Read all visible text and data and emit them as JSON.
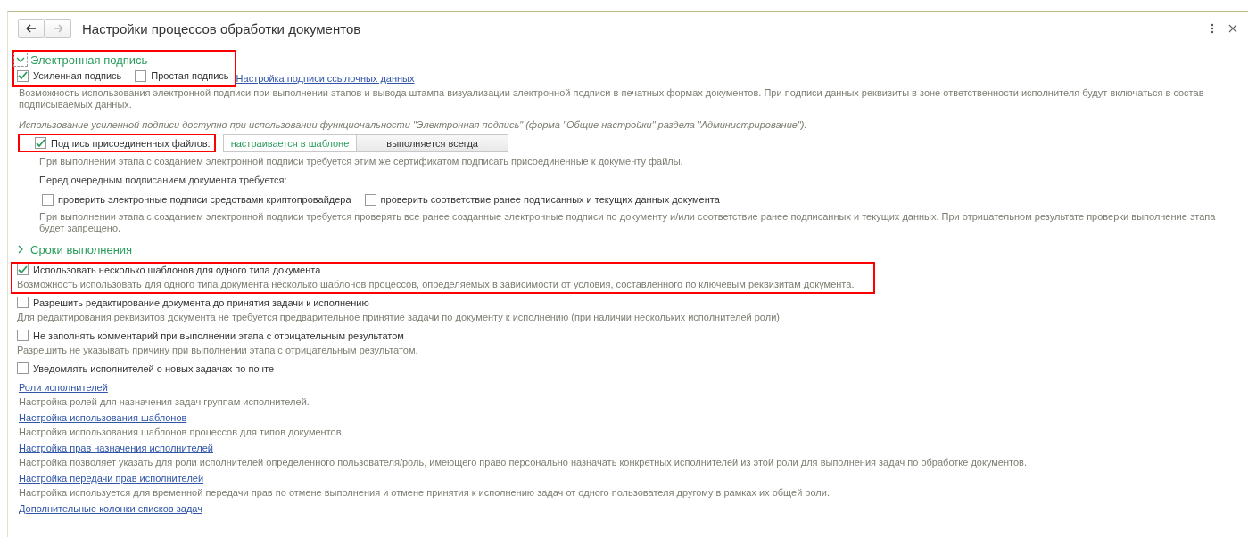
{
  "window": {
    "title": "Настройки процессов обработки документов"
  },
  "sections": [
    {
      "title": "Электронная подпись",
      "expanded": true,
      "highlighted": true,
      "signature_types": [
        {
          "label": "Усиленная подпись",
          "checked": true
        },
        {
          "label": "Простая подпись",
          "checked": false
        }
      ],
      "link": "Настройка подписи ссылочных данных",
      "description": "Возможность использования электронной подписи при выполнении этапов и вывода штампа визуализации электронной подписи в печатных формах документов. При подписи данных реквизиты в зоне ответственности исполнителя будут включаться в состав подписываемых данных.",
      "note": "Использование усиленной подписи доступно при использовании функциональности \"Электронная подпись\" (форма \"Общие настройки\" раздела \"Администрирование\").",
      "attached_files": {
        "label": "Подпись присоединенных файлов:",
        "checked": true,
        "highlighted": true,
        "modes": [
          {
            "label": "настраивается в шаблоне",
            "selected": true
          },
          {
            "label": "выполняется всегда",
            "selected": false
          }
        ],
        "description": "При выполнении этапа с созданием электронной подписи требуется этим же сертификатом подписать присоединенные к документу файлы."
      },
      "pre_sign_heading": "Перед очередным подписанием документа требуется:",
      "pre_sign_checks": [
        {
          "label": "проверить электронные подписи средствами криптопровайдера",
          "checked": false
        },
        {
          "label": "проверить соответствие ранее подписанных и текущих данных документа",
          "checked": false
        }
      ],
      "pre_sign_description": "При выполнении этапа с созданием электронной подписи требуется проверять все ранее созданные электронные подписи по документу и/или соответствие ранее подписанных и текущих данных. При отрицательном результате проверки выполнение этапа будет запрещено."
    },
    {
      "title": "Сроки выполнения",
      "expanded": false
    }
  ],
  "options": [
    {
      "kind": "checkbox",
      "label": "Использовать несколько шаблонов для одного типа документа",
      "checked": true,
      "highlighted": true,
      "description": "Возможность использовать для одного типа документа несколько шаблонов процессов, определяемых в зависимости от условия, составленного по ключевым реквизитам документа."
    },
    {
      "kind": "checkbox",
      "label": "Разрешить редактирование документа до принятия задачи к исполнению",
      "checked": false,
      "description": "Для редактирования реквизитов документа не требуется предварительное принятие задачи по документу к исполнению (при наличии нескольких исполнителей роли)."
    },
    {
      "kind": "checkbox",
      "label": "Не заполнять комментарий при выполнении этапа с отрицательным результатом",
      "checked": false,
      "description": "Разрешить не указывать причину при выполнении этапа с отрицательным результатом."
    },
    {
      "kind": "checkbox",
      "label": "Уведомлять исполнителей о новых задачах по почте",
      "checked": false
    },
    {
      "kind": "link",
      "label": "Роли исполнителей",
      "description": "Настройка ролей для назначения задач группам исполнителей."
    },
    {
      "kind": "link",
      "label": "Настройка использования шаблонов",
      "description": "Настройка использования шаблонов процессов для типов документов."
    },
    {
      "kind": "link",
      "label": "Настройка прав назначения исполнителей",
      "description": "Настройка позволяет указать для роли исполнителей определенного пользователя/роль, имеющего право персонально назначать конкретных исполнителей из этой роли для выполнения задач по обработке документов."
    },
    {
      "kind": "link",
      "label": "Настройка передачи прав исполнителей",
      "description": "Настройка используется для временной передачи прав по отмене выполнения и отмене принятия к исполнению задач от одного пользователя другому в рамках их общей роли."
    },
    {
      "kind": "link",
      "label": "Дополнительные колонки списков задач"
    }
  ]
}
